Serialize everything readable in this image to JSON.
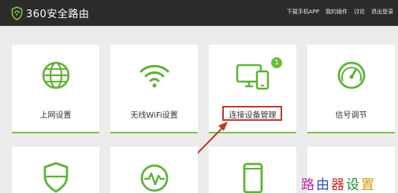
{
  "brand": {
    "name": "360安全路由"
  },
  "topnav": [
    "下载手机APP",
    "我的插件",
    "讨论",
    "退出登录"
  ],
  "tiles": [
    {
      "label": "上网设置",
      "icon": "globe-icon"
    },
    {
      "label": "无线WiFi设置",
      "icon": "wifi-icon"
    },
    {
      "label": "连接设备管理",
      "icon": "devices-icon",
      "badge": "1",
      "highlighted": true
    },
    {
      "label": "信号调节",
      "icon": "signal-gauge-icon"
    }
  ],
  "bottom_tiles_icons": [
    "shield-icon",
    "pulse-icon",
    "phone-icon",
    "blank"
  ],
  "watermark": {
    "chars": [
      "路",
      "由",
      "器",
      "设",
      "置"
    ],
    "colors": [
      "#c026a0",
      "#2f4fbf",
      "#d11f1f",
      "#1d8f2f",
      "#d29c00"
    ]
  },
  "colors": {
    "accent": "#7dc242",
    "arrow": "#c0392b",
    "topbar": "#2b2b2b"
  }
}
